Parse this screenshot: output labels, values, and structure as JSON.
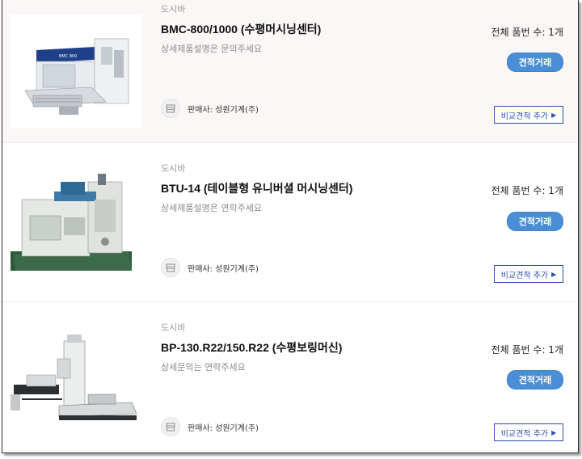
{
  "products": [
    {
      "brand": "도시바",
      "title": "BMC-800/1000 (수평머시닝센터)",
      "description": "상세제품설명은 문의주세요",
      "seller": "판매사: 성원기계(주)",
      "part_count": "전체 품번 수: 1개",
      "quote_label": "견적거래",
      "compare_label": "비교견적 추가",
      "image_badge": "BMC 800"
    },
    {
      "brand": "도시바",
      "title": "BTU-14 (테이블형 유니버셜 머시닝센터)",
      "description": "상세제품설명은 연락주세요",
      "seller": "판매사: 성원기계(주)",
      "part_count": "전체 품번 수: 1개",
      "quote_label": "견적거래",
      "compare_label": "비교견적 추가"
    },
    {
      "brand": "도시바",
      "title": "BP-130.R22/150.R22 (수평보링머신)",
      "description": "상세문의는 연락주세요",
      "seller": "판매사: 성원기계(주)",
      "part_count": "전체 품번 수: 1개",
      "quote_label": "견적거래",
      "compare_label": "비교견적 추가"
    }
  ],
  "colors": {
    "quote_button": "#4a8fd6",
    "compare_border": "#2d4ea8",
    "first_row_bg": "#fbf7f6"
  },
  "icons": {
    "seller": "storefront-icon",
    "compare_arrow": "caret-right-icon"
  }
}
